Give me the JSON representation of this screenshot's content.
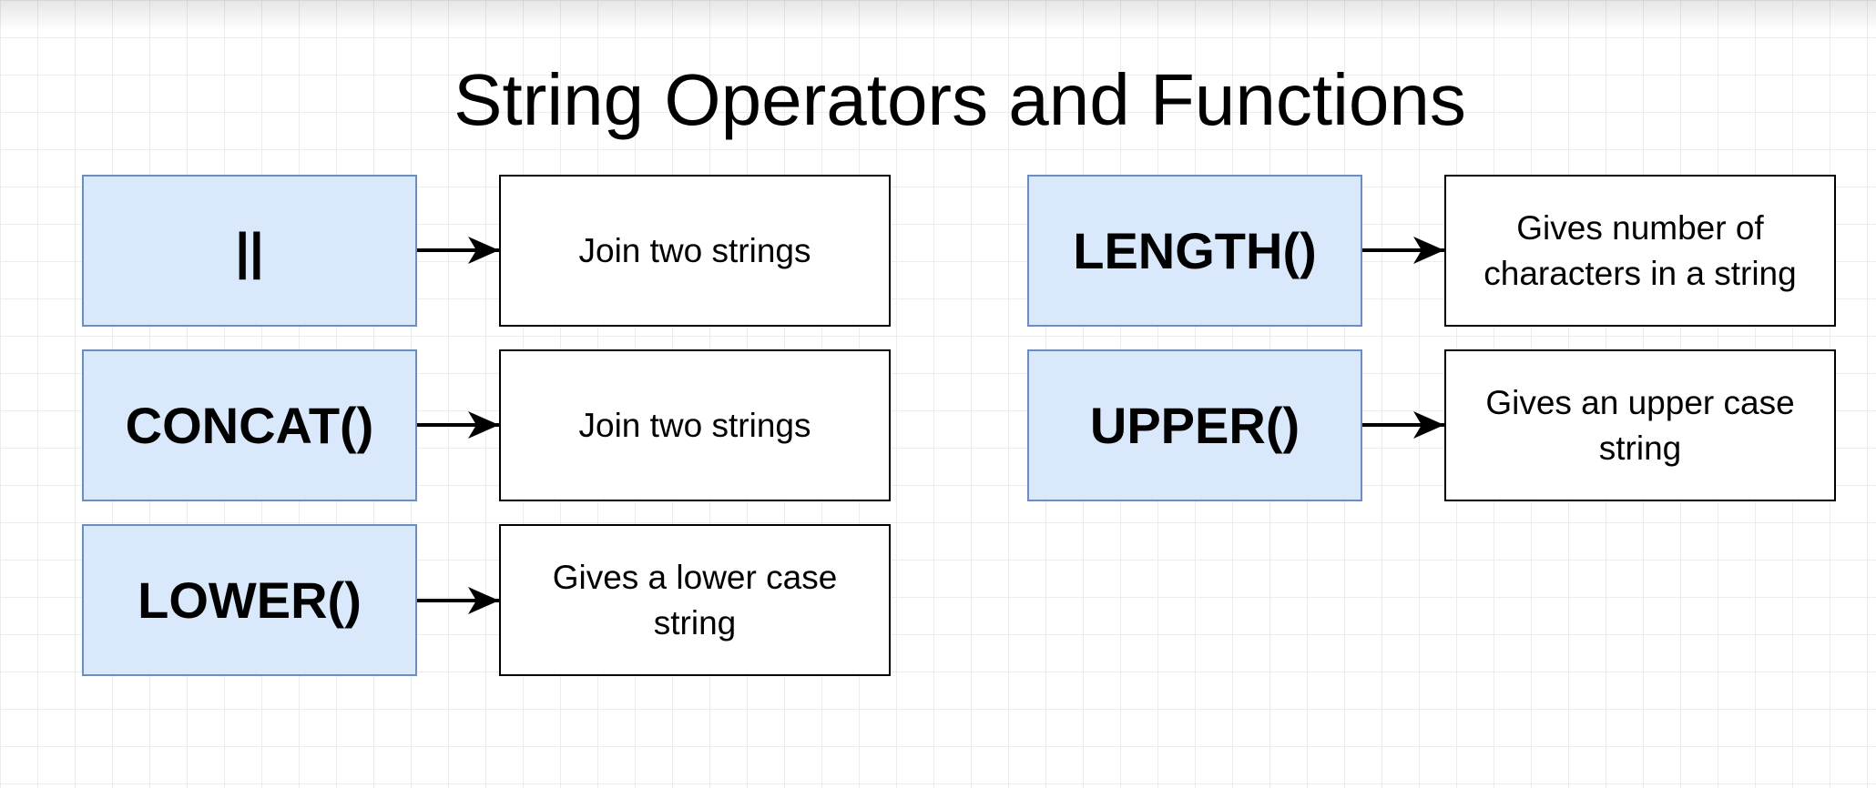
{
  "title": "String Operators and Functions",
  "rows": [
    {
      "operator": "||",
      "description": "Join two strings"
    },
    {
      "operator": "CONCAT()",
      "description": "Join two strings"
    },
    {
      "operator": "LOWER()",
      "description": "Gives a lower case string"
    },
    {
      "operator": "LENGTH()",
      "description": "Gives number of characters in a string"
    },
    {
      "operator": "UPPER()",
      "description": "Gives an upper case string"
    }
  ]
}
